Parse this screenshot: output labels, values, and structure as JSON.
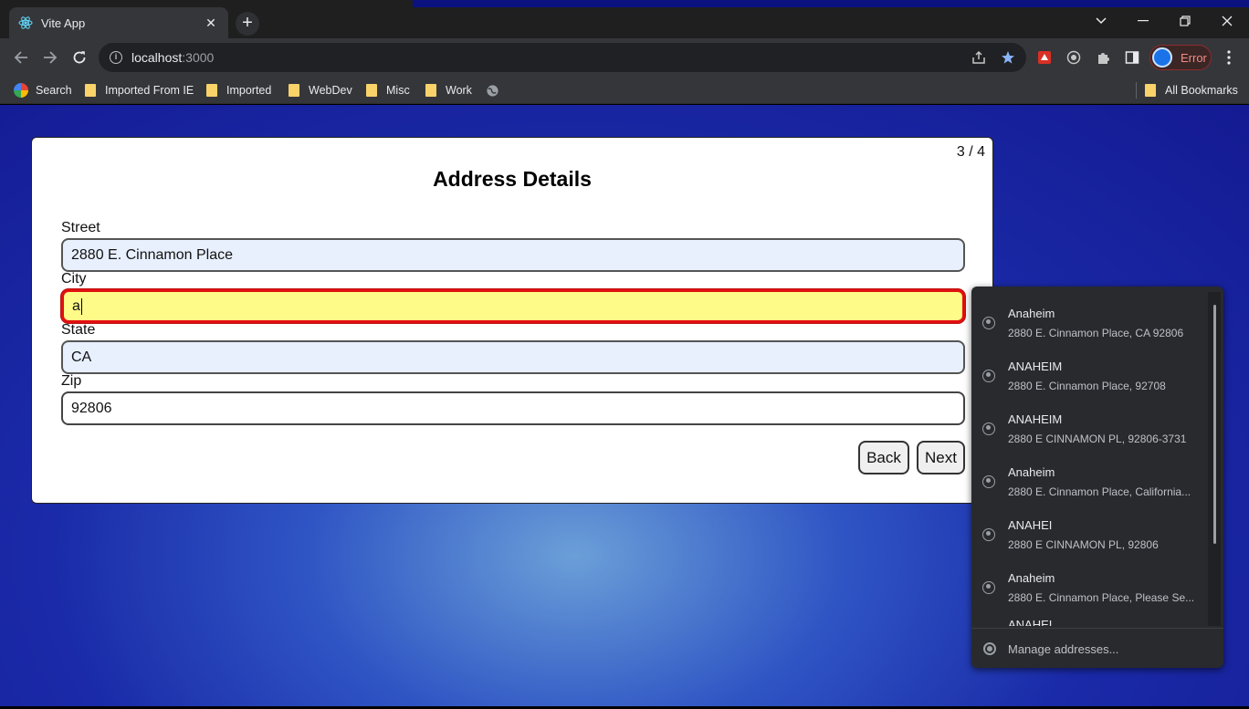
{
  "browser": {
    "tab_title": "Vite App",
    "tab_close": "✕",
    "new_tab": "+",
    "url_host": "localhost",
    "url_port": ":3000",
    "profile_status": "Error",
    "window_controls": [
      "minimize",
      "restore",
      "close"
    ],
    "bookmarks": [
      {
        "label": "Search",
        "icon": "google-icon"
      },
      {
        "label": "Imported From IE",
        "icon": "folder-icon"
      },
      {
        "label": "Imported",
        "icon": "folder-icon"
      },
      {
        "label": "WebDev",
        "icon": "folder-icon"
      },
      {
        "label": "Misc",
        "icon": "folder-icon"
      },
      {
        "label": "Work",
        "icon": "folder-icon"
      }
    ],
    "all_bookmarks": "All Bookmarks"
  },
  "form": {
    "step": "3 / 4",
    "title": "Address Details",
    "fields": {
      "street": {
        "label": "Street",
        "value": "2880 E. Cinnamon Place"
      },
      "city": {
        "label": "City",
        "value": "a"
      },
      "state": {
        "label": "State",
        "value": "CA"
      },
      "zip": {
        "label": "Zip",
        "value": "92806"
      }
    },
    "back_label": "Back",
    "next_label": "Next"
  },
  "autofill": {
    "items": [
      {
        "name": "Anaheim",
        "address": "2880 E. Cinnamon Place, CA 92806"
      },
      {
        "name": "ANAHEIM",
        "address": "2880 E. Cinnamon Place, 92708"
      },
      {
        "name": "ANAHEIM",
        "address": "2880 E CINNAMON PL, 92806-3731"
      },
      {
        "name": "Anaheim",
        "address": "2880 E. Cinnamon Place, California..."
      },
      {
        "name": "ANAHEI",
        "address": "2880 E CINNAMON PL, 92806"
      },
      {
        "name": "Anaheim",
        "address": "2880 E. Cinnamon Place, Please Se..."
      },
      {
        "name": "ANAHEI",
        "address": ""
      }
    ],
    "manage_label": "Manage addresses..."
  },
  "colors": {
    "page_gradient_center": "#6b9fd8",
    "page_gradient_edge": "#141a92",
    "focus_field_bg": "#fffb88",
    "focus_border": "#e01010",
    "autofill_bg": "#292a2d"
  }
}
